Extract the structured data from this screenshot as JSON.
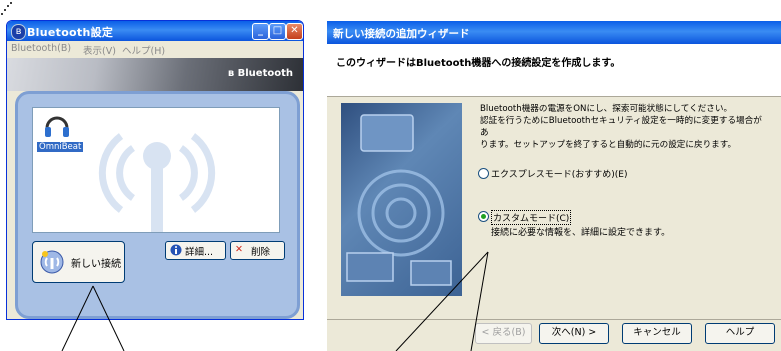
{
  "left_window": {
    "title": "Bluetooth設定",
    "menu": [
      "Bluetooth(B)",
      "表示(V)",
      "ヘルプ(H)"
    ],
    "banner_text": "Bluetooth",
    "device_name": "OmniBeat",
    "new_connection_label": "新しい接続",
    "details_label": "詳細...",
    "delete_label": "削除"
  },
  "wizard": {
    "title": "新しい接続の追加ウィザード",
    "header_text": "このウィザードはBluetooth機器への接続設定を作成します。",
    "description_lines": [
      "Bluetooth機器の電源をONにし、探索可能状態にしてください。",
      "認証を行うためにBluetoothセキュリティ設定を一時的に変更する場合があ",
      "ります。セットアップを終了すると自動的に元の設定に戻ります。"
    ],
    "option_express": "エクスプレスモード(おすすめ)(E)",
    "option_custom": "カスタムモード(C)",
    "option_custom_desc": "接続に必要な情報を、詳細に設定できます。",
    "selected_option": "custom",
    "back_label": "< 戻る(B)",
    "next_label": "次へ(N) >",
    "cancel_label": "キャンセル",
    "help_label": "ヘルプ"
  },
  "colors": {
    "xp_title_blue": "#0a5ee8",
    "panel_blue": "#a9c1e4",
    "selection_blue": "#316ac5",
    "radio_green": "#21a121"
  }
}
